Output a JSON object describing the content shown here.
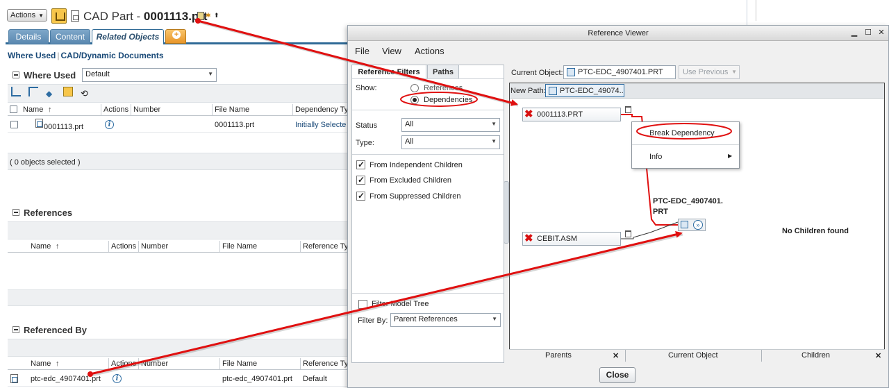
{
  "header": {
    "actions_label": "Actions",
    "title_prefix": "CAD Part - ",
    "title_name": "0001113.prt"
  },
  "tabs": [
    {
      "label": "Details"
    },
    {
      "label": "Content"
    },
    {
      "label": "Related Objects"
    }
  ],
  "nav": {
    "where_used": "Where Used",
    "cad_docs": "CAD/Dynamic Documents"
  },
  "where_used": {
    "title": "Where Used",
    "filter_value": "Default",
    "columns": [
      "Name",
      "Actions",
      "Number",
      "File Name",
      "Dependency Ty"
    ],
    "row": {
      "name": "0001113.prt",
      "file_name": "0001113.prt",
      "dependency": "Initially Selecte"
    },
    "selection_status": "( 0 objects selected )"
  },
  "references": {
    "title": "References",
    "columns": [
      "Name",
      "Actions",
      "Number",
      "File Name",
      "Reference Ty"
    ]
  },
  "referenced_by": {
    "title": "Referenced By",
    "columns": [
      "Name",
      "Actions",
      "Number",
      "File Name",
      "Reference Ty"
    ],
    "row": {
      "name": "ptc-edc_4907401.prt",
      "file_name": "ptc-edc_4907401.prt",
      "reference_type": "Default"
    }
  },
  "dialog": {
    "title": "Reference Viewer",
    "menu": [
      "File",
      "View",
      "Actions"
    ],
    "left_tabs": [
      "Reference Filters",
      "Paths"
    ],
    "show_label": "Show:",
    "radio_references": "References",
    "radio_dependencies": "Dependencies",
    "status_label": "Status",
    "status_value": "All",
    "type_label": "Type:",
    "type_value": "All",
    "checkboxes": [
      "From Independent Children",
      "From Excluded Children",
      "From Suppressed Children"
    ],
    "filter_model_tree": "Filter Model Tree",
    "filter_by_label": "Filter By:",
    "filter_by_value": "Parent References",
    "current_object_label": "Current Object:",
    "current_object_value": "PTC-EDC_4907401.PRT",
    "use_previous": "Use Previous",
    "new_path_label": "New Path:",
    "new_path_value": "PTC-EDC_49074...",
    "nodes": {
      "parent_1": "0001113.PRT",
      "parent_2": "CEBIT.ASM",
      "current_line1": "PTC-EDC_4907401.",
      "current_line2": "PRT",
      "no_children": "No Children found"
    },
    "context_menu": [
      "Break Dependency",
      "Info"
    ],
    "bottom_tabs": [
      "Parents",
      "Current Object",
      "Children"
    ],
    "close_label": "Close"
  },
  "colors": {
    "annotation_red": "#e01010",
    "tab_blue": "#5a88b0",
    "link_blue": "#1a4a78"
  }
}
